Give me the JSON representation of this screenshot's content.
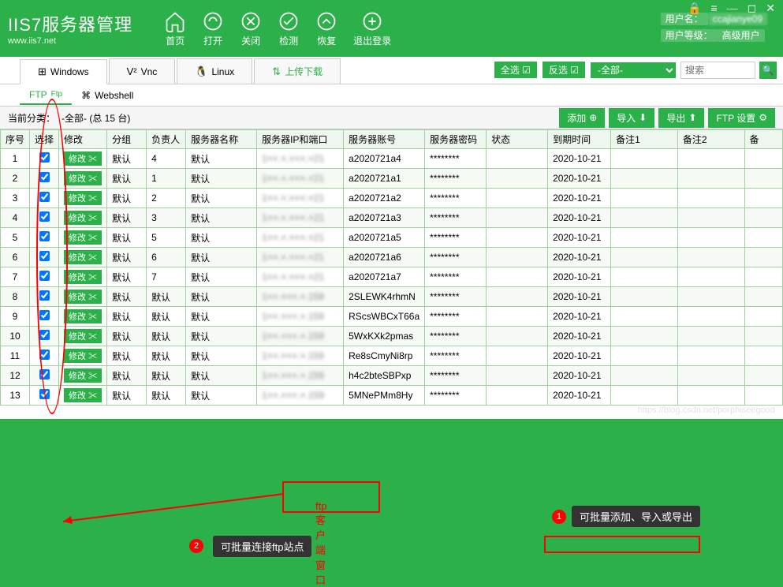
{
  "app": {
    "title_main": "IIS7服务器管理",
    "title_sub": "www.iis7.net"
  },
  "win": {
    "lock": "🔒",
    "menu": "≡",
    "min": "—",
    "max": "◻",
    "close": "✕"
  },
  "nav": [
    {
      "icon": "home",
      "label": "首页"
    },
    {
      "icon": "link",
      "label": "打开"
    },
    {
      "icon": "x",
      "label": "关闭"
    },
    {
      "icon": "check",
      "label": "检测"
    },
    {
      "icon": "wrench",
      "label": "恢复"
    },
    {
      "icon": "logout",
      "label": "退出登录"
    }
  ],
  "user": {
    "name_label": "用户名：",
    "name_value": "ccajianye09",
    "level_label": "用户等级：",
    "level_value": "高级用户"
  },
  "tabs1": [
    {
      "icon": "⊞",
      "label": "Windows"
    },
    {
      "icon": "V²",
      "label": "Vnc"
    },
    {
      "icon": "🐧",
      "label": "Linux"
    },
    {
      "icon": "⇅",
      "label": "上传下载"
    }
  ],
  "right": {
    "select_all": "全选",
    "invert": "反选",
    "cat": "-全部-",
    "search_ph": "搜索"
  },
  "tabs2": [
    {
      "label": "FTP",
      "sub": "Ftp"
    },
    {
      "label": "Webshell",
      "icon": "⌘"
    }
  ],
  "filter": {
    "prefix": "当前分类：",
    "cat": "-全部- (总 15 台)"
  },
  "actions": {
    "add": "添加",
    "import": "导入",
    "export": "导出",
    "ftp_set": "FTP 设置"
  },
  "cols": [
    "序号",
    "选择",
    "修改",
    "分组",
    "负责人",
    "服务器名称",
    "服务器IP和端口",
    "服务器账号",
    "服务器密码",
    "状态",
    "到期时间",
    "备注1",
    "备注2",
    "备"
  ],
  "mod_btn": "修改 ✂",
  "rows": [
    {
      "idx": "1",
      "grp": "默认",
      "own": "4",
      "name": "默认",
      "ip": "1××.×.×××.×21",
      "acc": "a2020721a4",
      "pwd": "********",
      "exp": "2020-10-21"
    },
    {
      "idx": "2",
      "grp": "默认",
      "own": "1",
      "name": "默认",
      "ip": "1××.×.×××.×21",
      "acc": "a2020721a1",
      "pwd": "********",
      "exp": "2020-10-21"
    },
    {
      "idx": "3",
      "grp": "默认",
      "own": "2",
      "name": "默认",
      "ip": "1××.×.×××.×21",
      "acc": "a2020721a2",
      "pwd": "********",
      "exp": "2020-10-21"
    },
    {
      "idx": "4",
      "grp": "默认",
      "own": "3",
      "name": "默认",
      "ip": "1××.×.×××.×21",
      "acc": "a2020721a3",
      "pwd": "********",
      "exp": "2020-10-21"
    },
    {
      "idx": "5",
      "grp": "默认",
      "own": "5",
      "name": "默认",
      "ip": "1××.×.×××.×21",
      "acc": "a2020721a5",
      "pwd": "********",
      "exp": "2020-10-21"
    },
    {
      "idx": "6",
      "grp": "默认",
      "own": "6",
      "name": "默认",
      "ip": "1××.×.×××.×21",
      "acc": "a2020721a6",
      "pwd": "********",
      "exp": "2020-10-21"
    },
    {
      "idx": "7",
      "grp": "默认",
      "own": "7",
      "name": "默认",
      "ip": "1××.×.×××.×21",
      "acc": "a2020721a7",
      "pwd": "********",
      "exp": "2020-10-21"
    },
    {
      "idx": "8",
      "grp": "默认",
      "own": "默认",
      "name": "默认",
      "ip": "1××.×××.×.159",
      "acc": "2SLEWK4rhmN",
      "pwd": "********",
      "exp": "2020-10-21"
    },
    {
      "idx": "9",
      "grp": "默认",
      "own": "默认",
      "name": "默认",
      "ip": "1××.×××.×.159",
      "acc": "RScsWBCxT66a",
      "pwd": "********",
      "exp": "2020-10-21"
    },
    {
      "idx": "10",
      "grp": "默认",
      "own": "默认",
      "name": "默认",
      "ip": "1××.×××.×.159",
      "acc": "5WxKXk2pmas",
      "pwd": "********",
      "exp": "2020-10-21"
    },
    {
      "idx": "11",
      "grp": "默认",
      "own": "默认",
      "name": "默认",
      "ip": "1××.×××.×.159",
      "acc": "Re8sCmyNi8rp",
      "pwd": "********",
      "exp": "2020-10-21"
    },
    {
      "idx": "12",
      "grp": "默认",
      "own": "默认",
      "name": "默认",
      "ip": "1××.×××.×.159",
      "acc": "h4c2bteSBPxp",
      "pwd": "********",
      "exp": "2020-10-21"
    },
    {
      "idx": "13",
      "grp": "默认",
      "own": "默认",
      "name": "默认",
      "ip": "1××.×××.×.159",
      "acc": "5MNePMm8Hy",
      "pwd": "********",
      "exp": "2020-10-21"
    }
  ],
  "anno": {
    "ftp_client": "ftp客户端窗口",
    "batch_connect": "可批量连接ftp站点",
    "batch_add": "可批量添加、导入或导出",
    "n1": "1",
    "n2": "2"
  },
  "watermark": "https://blog.csdn.net/porphiseegood"
}
